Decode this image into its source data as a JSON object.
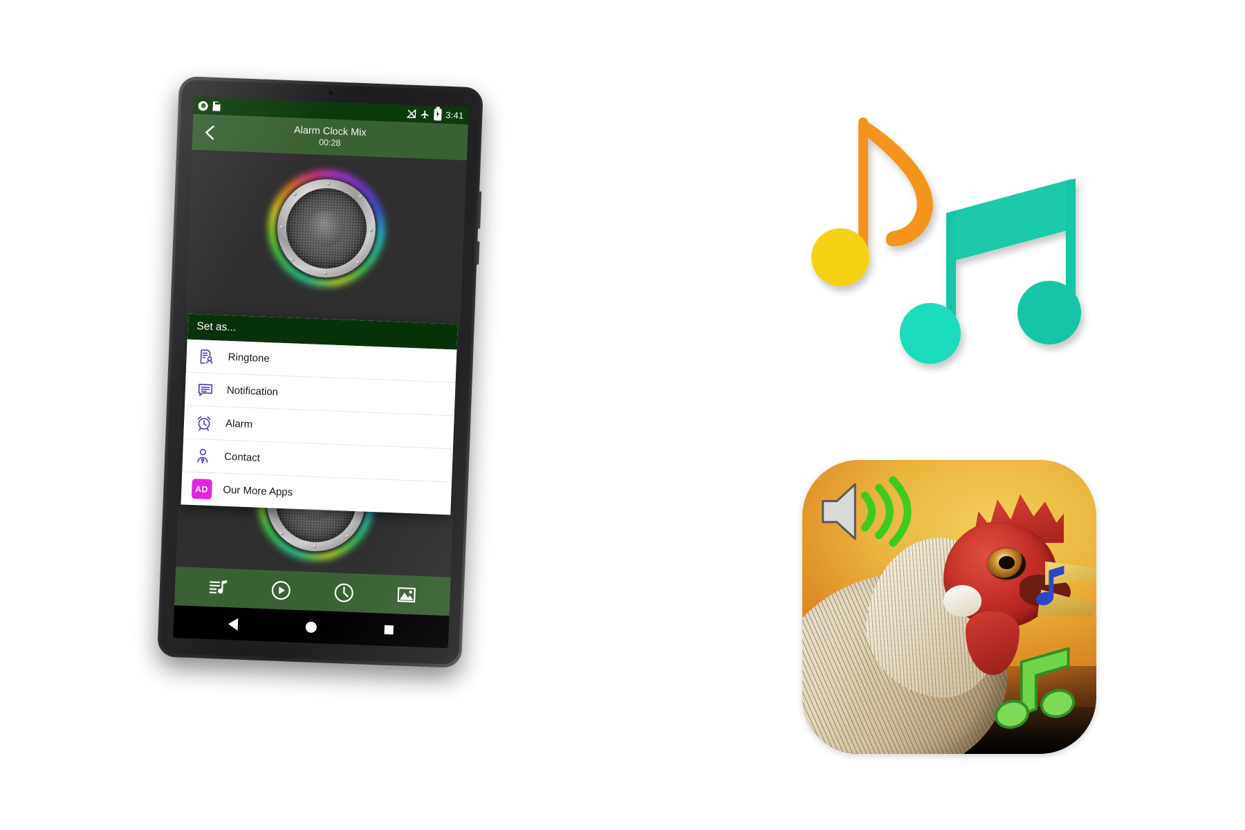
{
  "scene": {
    "background": "#ffffff",
    "description": "Android tablet mockup showing a ringtone app with a Set as dialog, beside music-note artwork and a rooster sounds app icon"
  },
  "device": {
    "type": "android-tablet",
    "frame_color": "#2b2b2d",
    "screen_background": "#2f2f2f"
  },
  "status_bar": {
    "background": "#0c3a0c",
    "left_icons": [
      "record-dot-icon",
      "sd-card-icon"
    ],
    "right_icons": [
      "no-signal-icon",
      "airplane-mode-icon",
      "battery-charging-icon"
    ],
    "time": "3:41"
  },
  "app_bar": {
    "background": "#3a6134",
    "back_icon": "chevron-left-icon",
    "title": "Alarm Clock Mix",
    "subtitle": "00:28"
  },
  "player": {
    "speaker_top": {
      "name": "speaker-graphic-top",
      "ring_colors": [
        "#22d3a0",
        "#8ddc2e",
        "#e8e020",
        "#f08b1c",
        "#ee3a7a",
        "#8b2fe8",
        "#3b55e8"
      ]
    },
    "speaker_bottom": {
      "name": "speaker-graphic-bottom"
    }
  },
  "dialog": {
    "title": "Set as...",
    "header_background": "#083308",
    "body_background": "#ffffff",
    "icon_color": "#5530d0",
    "items": [
      {
        "label": "Ringtone",
        "icon": "ringtone-contact-icon"
      },
      {
        "label": "Notification",
        "icon": "notification-message-icon"
      },
      {
        "label": "Alarm",
        "icon": "alarm-clock-icon"
      },
      {
        "label": "Contact",
        "icon": "contact-person-icon"
      },
      {
        "label": "Our More Apps",
        "icon": "ad-badge-icon",
        "badge": "AD",
        "badge_color": "#e324e3"
      }
    ]
  },
  "toolbar": {
    "background": "#3a6134",
    "buttons": [
      {
        "name": "playlist-music-button",
        "icon": "playlist-music-icon"
      },
      {
        "name": "play-button",
        "icon": "play-circle-icon"
      },
      {
        "name": "timer-button",
        "icon": "clock-icon"
      },
      {
        "name": "gallery-button",
        "icon": "image-icon"
      }
    ]
  },
  "nav_bar": {
    "background": "#000000",
    "buttons": [
      {
        "name": "nav-back-button",
        "icon": "back-triangle-icon"
      },
      {
        "name": "nav-home-button",
        "icon": "home-circle-icon"
      },
      {
        "name": "nav-recents-button",
        "icon": "recents-square-icon"
      }
    ]
  },
  "artwork": {
    "music_notes": {
      "name": "music-notes-illustration",
      "note_single_stem_color": "#f5941f",
      "note_single_head_color": "#f7d117",
      "note_beamed_color": "#1ec9a8",
      "note_beamed_head_color": "#12ccb0"
    },
    "app_icon": {
      "name": "rooster-sounds-app-icon",
      "background_gradient": [
        "#f4cf5b",
        "#df9127",
        "#17100a"
      ],
      "overlays": [
        "speaker-volume-icon",
        "blue-music-note-icon",
        "green-music-note-icon"
      ],
      "speaker_wave_color": "#3ecb1e",
      "blue_note_color": "#2a49c8",
      "green_note_color": "#6fd44a"
    }
  }
}
